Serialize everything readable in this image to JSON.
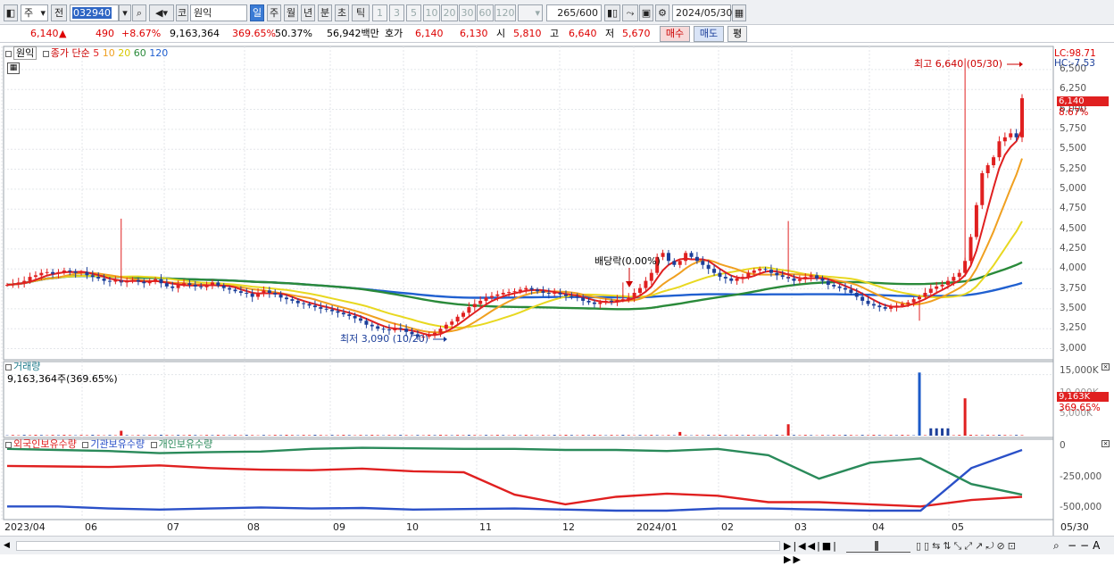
{
  "toolbar": {
    "market": "주",
    "prev": "전",
    "code": "032940",
    "market_label": "코",
    "name": "원익",
    "periods": [
      "일",
      "주",
      "월",
      "년",
      "분",
      "초",
      "틱"
    ],
    "minutes": [
      "1",
      "3",
      "5",
      "10",
      "20",
      "30",
      "60",
      "120"
    ],
    "count": "265",
    "count_max": "/600",
    "date": "2024/05/30"
  },
  "quote": {
    "price": "6,140",
    "change_arrow": "▲",
    "change": "490",
    "change_pct": "+8.67%",
    "volume": "9,163,364",
    "volume_pct": "369.65%",
    "turnover": "50.37%",
    "amount": "56,942백만",
    "hoga_label": "호가",
    "ask": "6,140",
    "bid": "6,130",
    "open_label": "시",
    "open": "5,810",
    "high_label": "고",
    "high": "6,640",
    "low_label": "저",
    "low": "5,670",
    "buy": "매수",
    "sell": "매도",
    "avg": "평"
  },
  "legend": {
    "name": "원익",
    "ma_label": "종가 단순",
    "ma_periods": [
      "5",
      "10",
      "20",
      "60",
      "120"
    ],
    "ma_colors": [
      "#e02020",
      "#f0a020",
      "#e8d820",
      "#2a8a3a",
      "#2060d0"
    ]
  },
  "annotations": {
    "lc": "LC:98.71",
    "hc": "HC:-7.53",
    "max": "최고 6,640 (05/30)",
    "min": "최저 3,090 (10/20)",
    "dividend": "배당락(0.00%)",
    "price_tag": "6,140",
    "pct_tag": "8.67%",
    "vol_tag": "9,163K",
    "vol_pct_tag": "369.65%"
  },
  "volume_panel": {
    "title": "거래량",
    "value": "9,163,364주(369.65%)",
    "yticks": [
      "15,000K",
      "10,000K",
      "5,000K"
    ]
  },
  "holding_panel": {
    "series": [
      {
        "name": "외국인보유수량",
        "color": "#e02020"
      },
      {
        "name": "기관보유수량",
        "color": "#2a50c8"
      },
      {
        "name": "개인보유수량",
        "color": "#2a8a5a"
      }
    ],
    "yticks": [
      "0",
      "-250,000",
      "-500,000"
    ]
  },
  "chart_data": {
    "type": "candlestick",
    "price_yticks": [
      "6,500",
      "6,250",
      "6,000",
      "5,750",
      "5,500",
      "5,250",
      "5,000",
      "4,750",
      "4,500",
      "4,250",
      "4,000",
      "3,750",
      "3,500",
      "3,250",
      "3,000"
    ],
    "ylim": [
      2950,
      6700
    ],
    "x_labels": [
      "2023/04",
      "06",
      "07",
      "08",
      "09",
      "10",
      "11",
      "12",
      "2024/01",
      "02",
      "03",
      "04",
      "05",
      "05/30"
    ],
    "close_series": [
      3800,
      3810,
      3830,
      3850,
      3900,
      3920,
      3950,
      3960,
      3940,
      3960,
      3980,
      3970,
      3950,
      3960,
      3920,
      3900,
      3880,
      3850,
      3840,
      3860,
      3830,
      3850,
      3860,
      3840,
      3820,
      3850,
      3870,
      3820,
      3780,
      3760,
      3800,
      3820,
      3800,
      3780,
      3770,
      3800,
      3830,
      3790,
      3760,
      3740,
      3720,
      3700,
      3690,
      3650,
      3700,
      3730,
      3700,
      3680,
      3640,
      3620,
      3600,
      3570,
      3560,
      3540,
      3520,
      3500,
      3490,
      3470,
      3450,
      3430,
      3410,
      3380,
      3350,
      3300,
      3280,
      3250,
      3240,
      3230,
      3260,
      3250,
      3210,
      3180,
      3150,
      3150,
      3170,
      3200,
      3250,
      3300,
      3340,
      3400,
      3450,
      3520,
      3560,
      3600,
      3640,
      3660,
      3680,
      3700,
      3710,
      3720,
      3740,
      3760,
      3740,
      3720,
      3700,
      3690,
      3700,
      3680,
      3660,
      3650,
      3640,
      3600,
      3580,
      3560,
      3580,
      3600,
      3590,
      3610,
      3620,
      3640,
      3700,
      3760,
      3850,
      3950,
      4150,
      4200,
      4100,
      4050,
      4100,
      4200,
      4150,
      4100,
      4050,
      4000,
      3950,
      3900,
      3880,
      3850,
      3880,
      3900,
      3950,
      3980,
      4000,
      3990,
      3950,
      3920,
      3900,
      3880,
      3850,
      3870,
      3900,
      3920,
      3880,
      3850,
      3800,
      3780,
      3760,
      3740,
      3700,
      3650,
      3600,
      3560,
      3540,
      3520,
      3500,
      3520,
      3540,
      3560,
      3580,
      3620,
      3650,
      3700,
      3750,
      3780,
      3800,
      3850,
      3900,
      3950,
      4100,
      4400,
      4800,
      5200,
      5300,
      5400,
      5600,
      5650,
      5700,
      5650,
      6140
    ],
    "volume_peaks_k": [
      {
        "label": "06",
        "value": 1200
      },
      {
        "label": "2024/01",
        "value": 900
      },
      {
        "label": "03",
        "value": 2800
      },
      {
        "label": "05",
        "value": 15500
      },
      {
        "label": "05/30",
        "value": 9163
      }
    ],
    "holdings": {
      "foreign": [
        -180,
        -185,
        -190,
        -175,
        -200,
        -215,
        -220,
        -205,
        -230,
        -240,
        -450,
        -540,
        -470,
        -440,
        -460,
        -520,
        -520,
        -540,
        -560,
        -500,
        -470
      ],
      "institution": [
        -560,
        -560,
        -580,
        -590,
        -580,
        -570,
        -580,
        -575,
        -590,
        -585,
        -580,
        -590,
        -600,
        -600,
        -580,
        -580,
        -590,
        -600,
        -600,
        -200,
        -30
      ],
      "individual": [
        -20,
        -30,
        -40,
        -60,
        -50,
        -45,
        -20,
        -10,
        -15,
        -20,
        -20,
        -30,
        -30,
        -40,
        -20,
        -80,
        -300,
        -150,
        -110,
        -350,
        -450
      ]
    }
  }
}
